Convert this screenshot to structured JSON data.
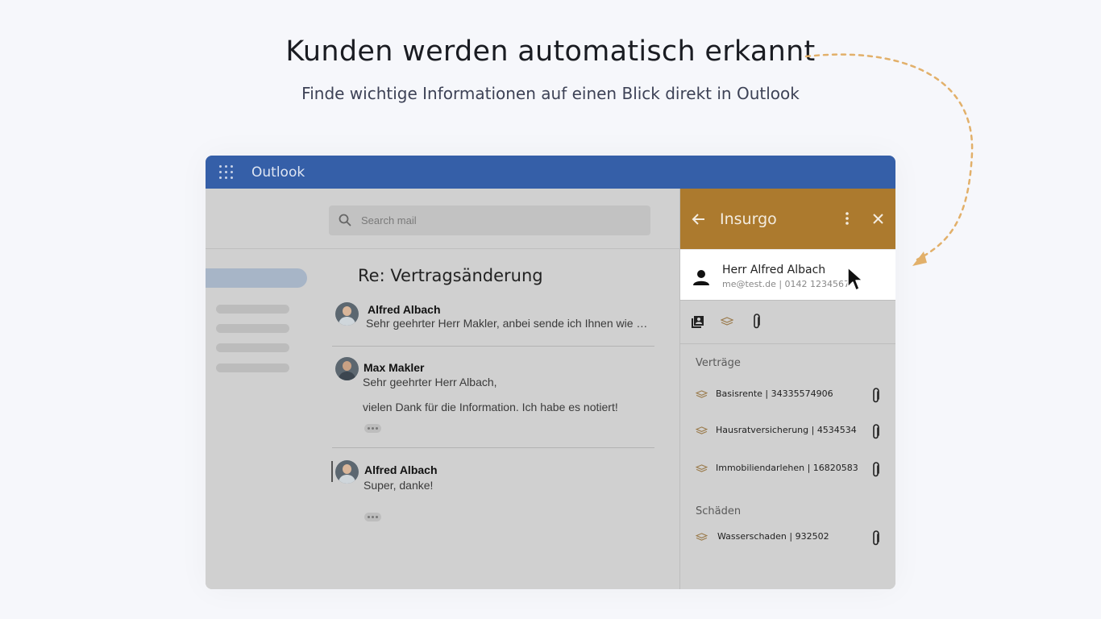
{
  "hero": {
    "title": "Kunden werden automatisch erkannt",
    "subtitle": "Finde wichtige Informationen auf einen Blick direkt in Outlook"
  },
  "app": {
    "title": "Outlook"
  },
  "search": {
    "placeholder": "Search mail"
  },
  "thread": {
    "subject": "Re: Vertragsänderung",
    "messages": [
      {
        "sender": "Alfred Albach",
        "preview": "Sehr geehrter Herr Makler, anbei sende ich Ihnen wie …"
      },
      {
        "sender": "Max Makler",
        "preview": "Sehr geehrter Herr Albach,",
        "body": "vielen Dank für die Information. Ich habe es notiert!"
      },
      {
        "sender": "Alfred Albach",
        "preview": "Super, danke!"
      }
    ]
  },
  "sidebar": {
    "title": "Insurgo",
    "contact": {
      "name": "Herr Alfred Albach",
      "info": "me@test.de | 0142 1234567"
    },
    "contracts_label": "Verträge",
    "contracts": [
      {
        "label": "Basisrente | 34335574906"
      },
      {
        "label": "Hausratversicherung | 4534534"
      },
      {
        "label": "Immobiliendarlehen | 16820583"
      }
    ],
    "damages_label": "Schäden",
    "damages": [
      {
        "label": "Wasserschaden | 932502"
      }
    ]
  },
  "colors": {
    "outlook_blue": "#355fa8",
    "insurgo_gold": "#ac7a2e",
    "arrow": "#e2b06a"
  }
}
